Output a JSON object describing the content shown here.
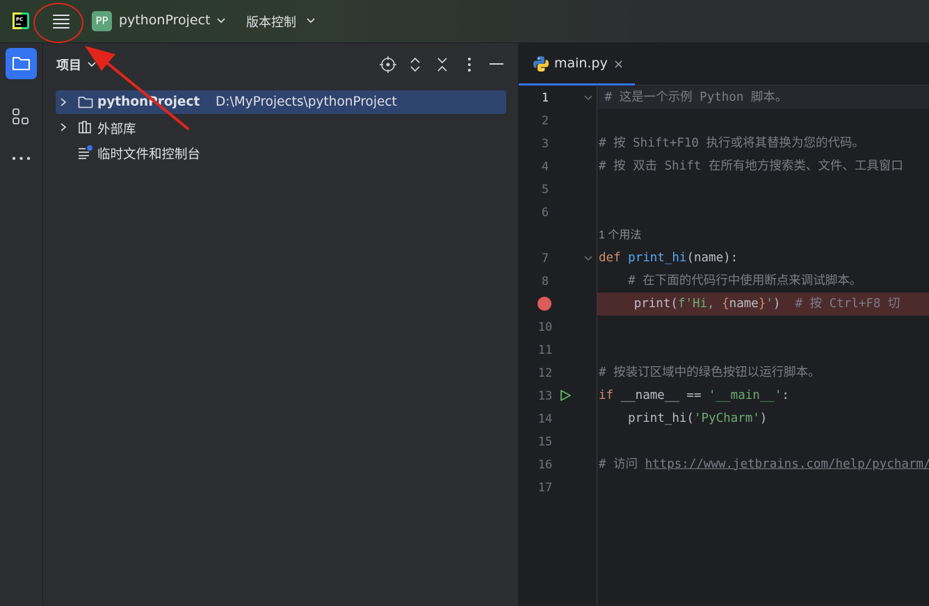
{
  "titlebar": {
    "project_badge": "PP",
    "project_name": "pythonProject",
    "vcs_label": "版本控制",
    "icons": [
      "pycharm-logo-icon",
      "hamburger-menu-icon",
      "chevron-down-icon"
    ]
  },
  "toolstrip": {
    "items": [
      "folder-icon",
      "structure-icon",
      "more-icon"
    ]
  },
  "project_panel": {
    "title": "项目",
    "actions": [
      "locate-icon",
      "expand-all-icon",
      "collapse-all-icon",
      "options-icon",
      "minimize-icon"
    ],
    "tree": [
      {
        "label": "pythonProject",
        "path": "D:\\MyProjects\\pythonProject"
      },
      {
        "label": "外部库"
      },
      {
        "label": "临时文件和控制台"
      }
    ]
  },
  "editor": {
    "tab": {
      "label": "main.py",
      "close": "×"
    },
    "lines": [
      {
        "n": "1",
        "parts": [
          {
            "c": "cm",
            "t": "# 这是一个示例 Python 脚本。"
          }
        ]
      },
      {
        "n": "2",
        "parts": []
      },
      {
        "n": "3",
        "parts": [
          {
            "c": "cm",
            "t": "# 按 Shift+F10 执行或将其替换为您的代码。"
          }
        ]
      },
      {
        "n": "4",
        "parts": [
          {
            "c": "cm",
            "t": "# 按 双击 Shift 在所有地方搜索类、文件、工具窗口"
          }
        ]
      },
      {
        "n": "5",
        "parts": []
      },
      {
        "n": "6",
        "parts": []
      },
      {
        "n": "",
        "parts": [
          {
            "c": "hint",
            "t": "1 个用法"
          }
        ]
      },
      {
        "n": "7",
        "parts": [
          {
            "c": "kw",
            "t": "def "
          },
          {
            "c": "fn",
            "t": "print_hi"
          },
          {
            "c": "tx",
            "t": "(name):"
          }
        ]
      },
      {
        "n": "8",
        "parts": [
          {
            "c": "cm",
            "t": "    # 在下面的代码行中使用断点来调试脚本。"
          }
        ]
      },
      {
        "n": "9",
        "parts": [
          {
            "c": "tx",
            "t": "    print("
          },
          {
            "c": "st",
            "t": "f'Hi, "
          },
          {
            "c": "kw",
            "t": "{"
          },
          {
            "c": "tx",
            "t": "name"
          },
          {
            "c": "kw",
            "t": "}"
          },
          {
            "c": "st",
            "t": "'"
          },
          {
            "c": "tx",
            "t": ")  "
          },
          {
            "c": "cm",
            "t": "# 按 Ctrl+F8 切"
          }
        ]
      },
      {
        "n": "10",
        "parts": []
      },
      {
        "n": "11",
        "parts": []
      },
      {
        "n": "12",
        "parts": [
          {
            "c": "cm",
            "t": "# 按装订区域中的绿色按钮以运行脚本。"
          }
        ]
      },
      {
        "n": "13",
        "parts": [
          {
            "c": "kw",
            "t": "if "
          },
          {
            "c": "tx",
            "t": "__name__ == "
          },
          {
            "c": "st",
            "t": "'__main__'"
          },
          {
            "c": "tx",
            "t": ":"
          }
        ]
      },
      {
        "n": "14",
        "parts": [
          {
            "c": "tx",
            "t": "    print_hi("
          },
          {
            "c": "st",
            "t": "'PyCharm'"
          },
          {
            "c": "tx",
            "t": ")"
          }
        ]
      },
      {
        "n": "15",
        "parts": []
      },
      {
        "n": "16",
        "parts": [
          {
            "c": "cm",
            "t": "# 访问 "
          },
          {
            "c": "url",
            "t": "https://www.jetbrains.com/help/pycharm/"
          }
        ]
      },
      {
        "n": "17",
        "parts": []
      }
    ]
  },
  "colors": {
    "accent": "#3574f0",
    "annotation": "#e1251b",
    "breakpoint": "#db5c5c",
    "run": "#5fb865"
  }
}
